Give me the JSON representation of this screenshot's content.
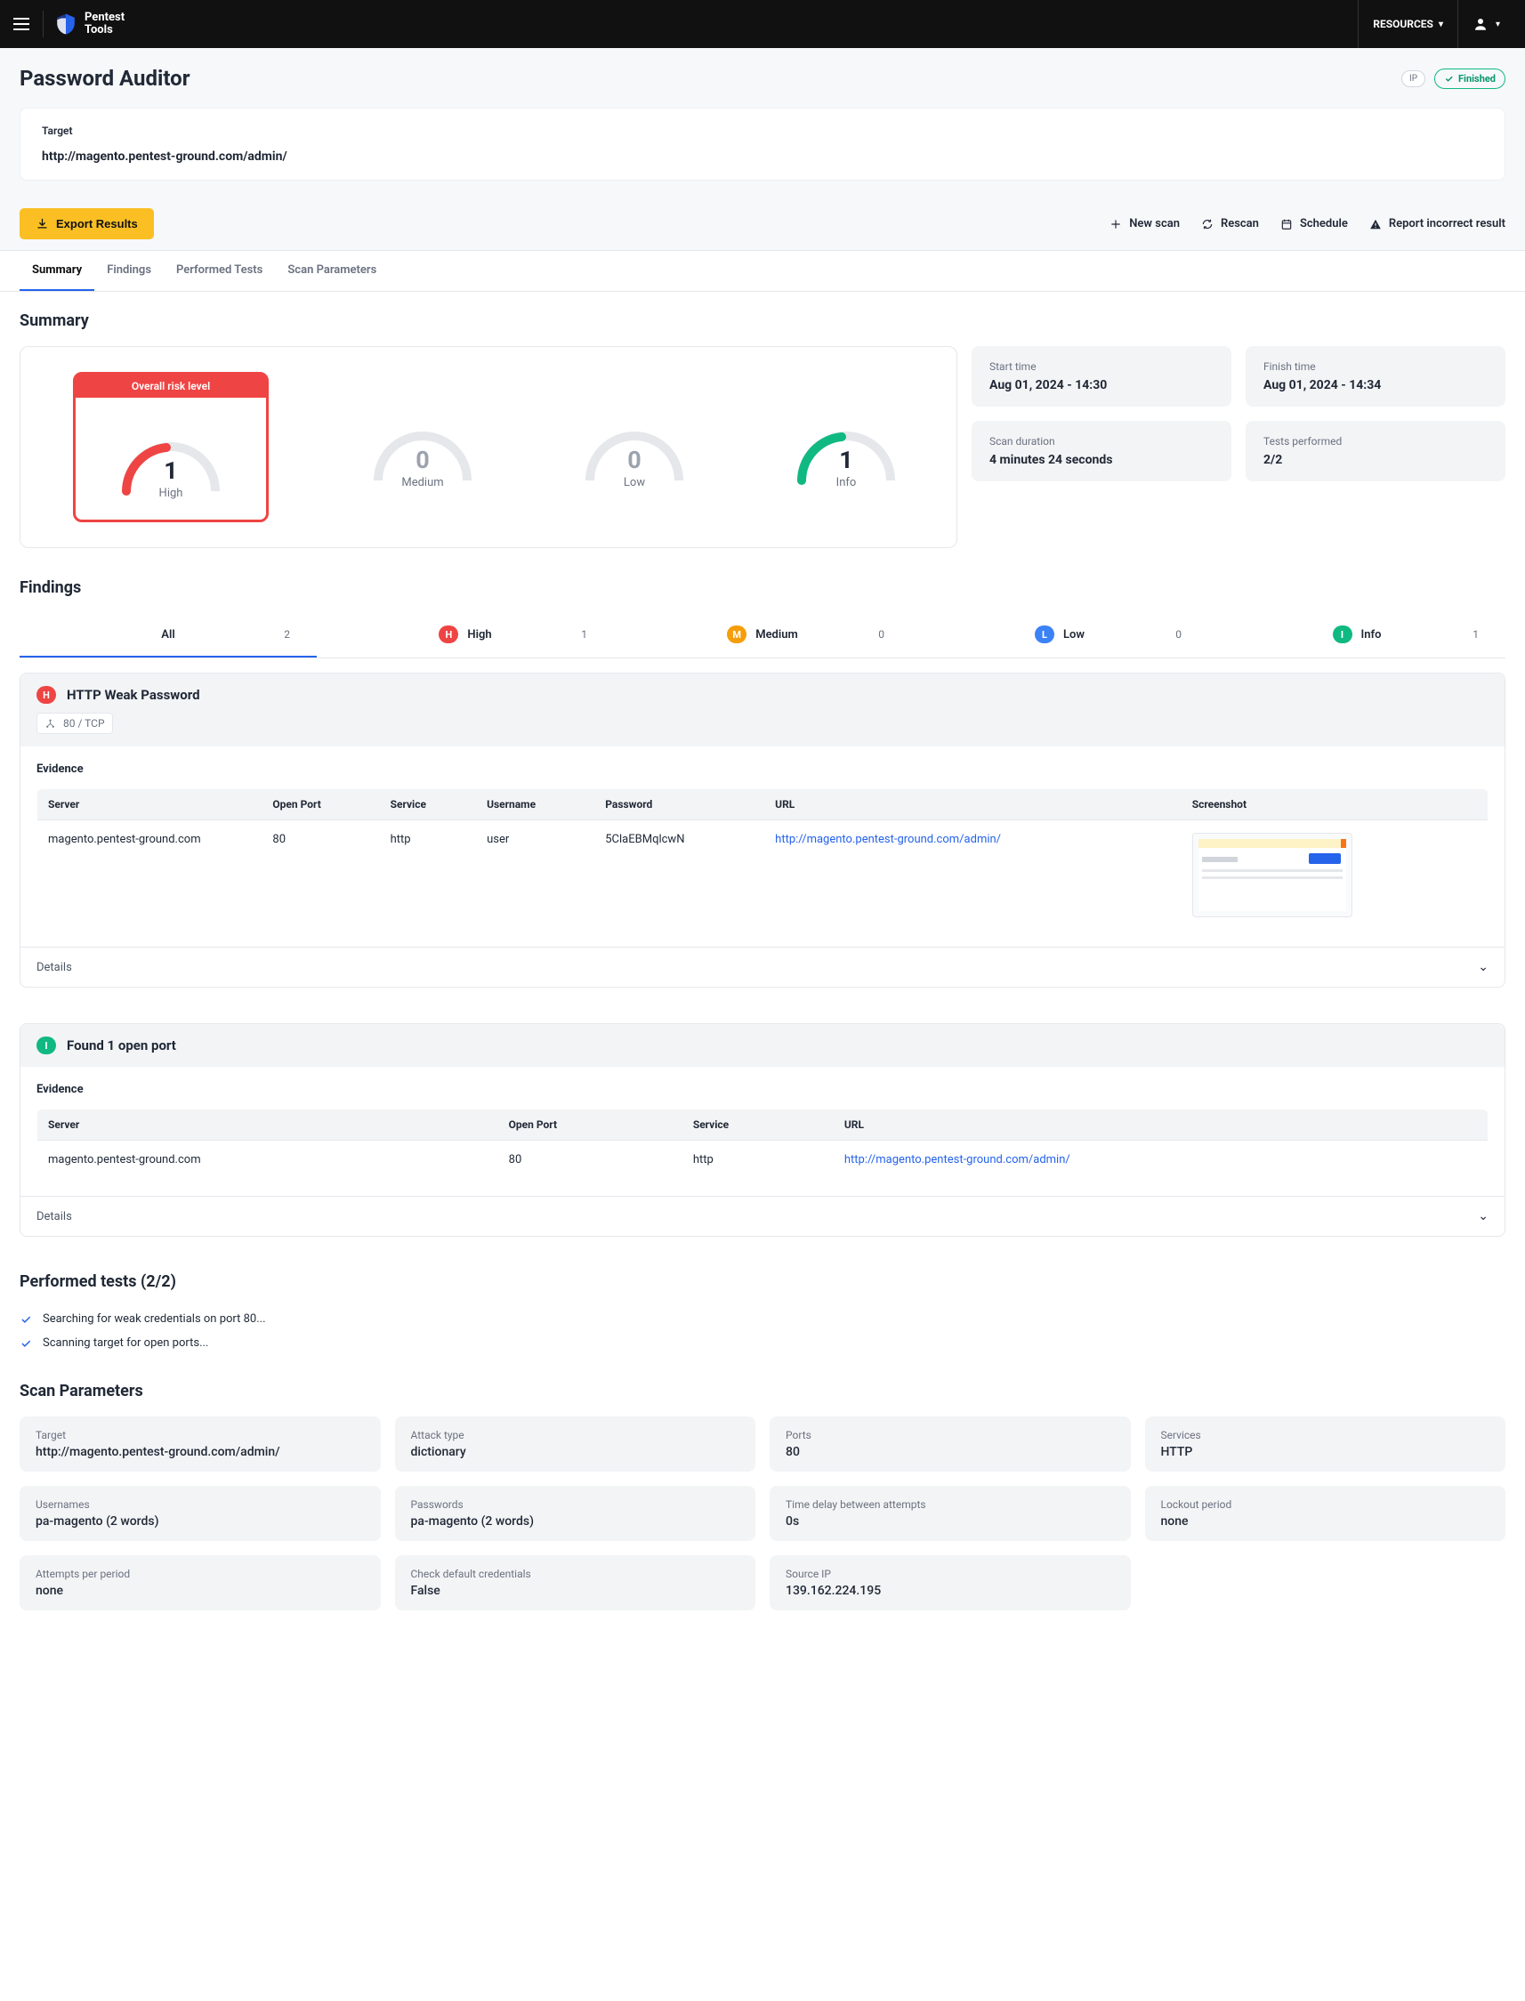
{
  "topbar": {
    "logo_line1": "Pentest",
    "logo_line2": "Tools",
    "resources": "RESOURCES"
  },
  "header": {
    "title": "Password Auditor",
    "ip_badge": "IP",
    "finished": "Finished"
  },
  "target": {
    "label": "Target",
    "value": "http://magento.pentest-ground.com/admin/"
  },
  "actions": {
    "export": "Export Results",
    "newscan": "New scan",
    "rescan": "Rescan",
    "schedule": "Schedule",
    "report": "Report incorrect result"
  },
  "tabs": {
    "summary": "Summary",
    "findings": "Findings",
    "performed": "Performed Tests",
    "params": "Scan Parameters"
  },
  "summary": {
    "title": "Summary",
    "overall_label": "Overall risk level",
    "high_count": "1",
    "high_label": "High",
    "med_count": "0",
    "med_label": "Medium",
    "low_count": "0",
    "low_label": "Low",
    "info_count": "1",
    "info_label": "Info",
    "start_label": "Start time",
    "start_value": "Aug 01, 2024 - 14:30",
    "finish_label": "Finish time",
    "finish_value": "Aug 01, 2024 - 14:34",
    "duration_label": "Scan duration",
    "duration_value": "4 minutes 24 seconds",
    "tests_label": "Tests performed",
    "tests_value": "2/2"
  },
  "findings": {
    "title": "Findings",
    "all": "All",
    "all_count": "2",
    "high": "High",
    "high_count": "1",
    "med": "Medium",
    "med_count": "0",
    "low": "Low",
    "low_count": "0",
    "info": "Info",
    "info_count": "1"
  },
  "f1": {
    "sev": "H",
    "title": "HTTP Weak Password",
    "port": "80 / TCP",
    "evidence": "Evidence",
    "h_server": "Server",
    "h_port": "Open Port",
    "h_service": "Service",
    "h_user": "Username",
    "h_pass": "Password",
    "h_url": "URL",
    "h_shot": "Screenshot",
    "server": "magento.pentest-ground.com",
    "open_port": "80",
    "service": "http",
    "username": "user",
    "password": "5ClaEBMqlcwN",
    "url": "http://magento.pentest-ground.com/admin/",
    "details": "Details"
  },
  "f2": {
    "sev": "I",
    "title": "Found 1 open port",
    "evidence": "Evidence",
    "h_server": "Server",
    "h_port": "Open Port",
    "h_service": "Service",
    "h_url": "URL",
    "server": "magento.pentest-ground.com",
    "open_port": "80",
    "service": "http",
    "url": "http://magento.pentest-ground.com/admin/",
    "details": "Details"
  },
  "performed": {
    "title": "Performed tests (2/2)",
    "item1": "Searching for weak credentials on port 80...",
    "item2": "Scanning target for open ports..."
  },
  "params": {
    "title": "Scan Parameters",
    "p1l": "Target",
    "p1v": "http://magento.pentest-ground.com/admin/",
    "p2l": "Attack type",
    "p2v": "dictionary",
    "p3l": "Ports",
    "p3v": "80",
    "p4l": "Services",
    "p4v": "HTTP",
    "p5l": "Usernames",
    "p5v": "pa-magento (2 words)",
    "p6l": "Passwords",
    "p6v": "pa-magento (2 words)",
    "p7l": "Time delay between attempts",
    "p7v": "0s",
    "p8l": "Lockout period",
    "p8v": "none",
    "p9l": "Attempts per period",
    "p9v": "none",
    "p10l": "Check default credentials",
    "p10v": "False",
    "p11l": "Source IP",
    "p11v": "139.162.224.195"
  }
}
